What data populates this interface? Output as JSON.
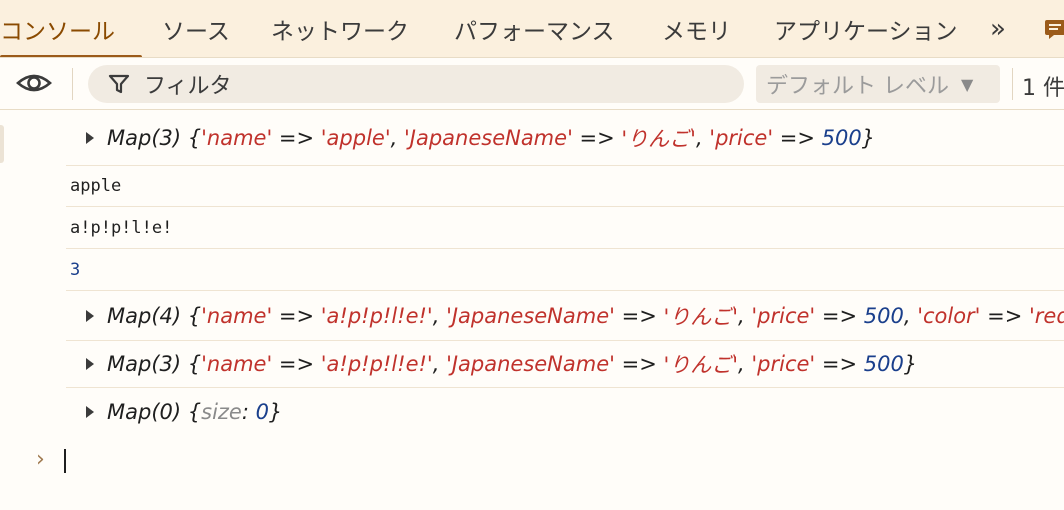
{
  "tabs": [
    {
      "label": "コンソール",
      "active": true
    },
    {
      "label": "ソース",
      "active": false
    },
    {
      "label": "ネットワーク",
      "active": false
    },
    {
      "label": "パフォーマンス",
      "active": false
    },
    {
      "label": "メモリ",
      "active": false
    },
    {
      "label": "アプリケーション",
      "active": false
    }
  ],
  "more_tabs": "»",
  "filter": {
    "placeholder": "フィルタ",
    "levels_label": "デフォルト レベル",
    "issue_count": "1 件"
  },
  "console": {
    "rows": [
      {
        "kind": "map",
        "header": "Map(3)",
        "entries": [
          {
            "key": "'name'",
            "value": "'apple'",
            "vtype": "string"
          },
          {
            "key": "'JapaneseName'",
            "value": "'りんご'",
            "vtype": "string"
          },
          {
            "key": "'price'",
            "value": "500",
            "vtype": "number"
          }
        ]
      },
      {
        "kind": "text",
        "text": "apple"
      },
      {
        "kind": "text",
        "text": "a!p!p!l!e!"
      },
      {
        "kind": "number",
        "text": "3"
      },
      {
        "kind": "map",
        "header": "Map(4)",
        "entries": [
          {
            "key": "'name'",
            "value": "'a!p!p!l!e!'",
            "vtype": "string"
          },
          {
            "key": "'JapaneseName'",
            "value": "'りんご'",
            "vtype": "string"
          },
          {
            "key": "'price'",
            "value": "500",
            "vtype": "number"
          },
          {
            "key": "'color'",
            "value": "'red'",
            "vtype": "string"
          }
        ]
      },
      {
        "kind": "map",
        "header": "Map(3)",
        "entries": [
          {
            "key": "'name'",
            "value": "'a!p!p!l!e!'",
            "vtype": "string"
          },
          {
            "key": "'JapaneseName'",
            "value": "'りんご'",
            "vtype": "string"
          },
          {
            "key": "'price'",
            "value": "500",
            "vtype": "number"
          }
        ]
      },
      {
        "kind": "map-empty",
        "header": "Map(0)",
        "size_key": "size",
        "size_value": "0"
      }
    ],
    "prompt": "›"
  },
  "colors": {
    "accent": "#9b5b1a",
    "string": "#c0322c",
    "number": "#1a3f8c",
    "tabbar_bg": "#fbf0de"
  }
}
